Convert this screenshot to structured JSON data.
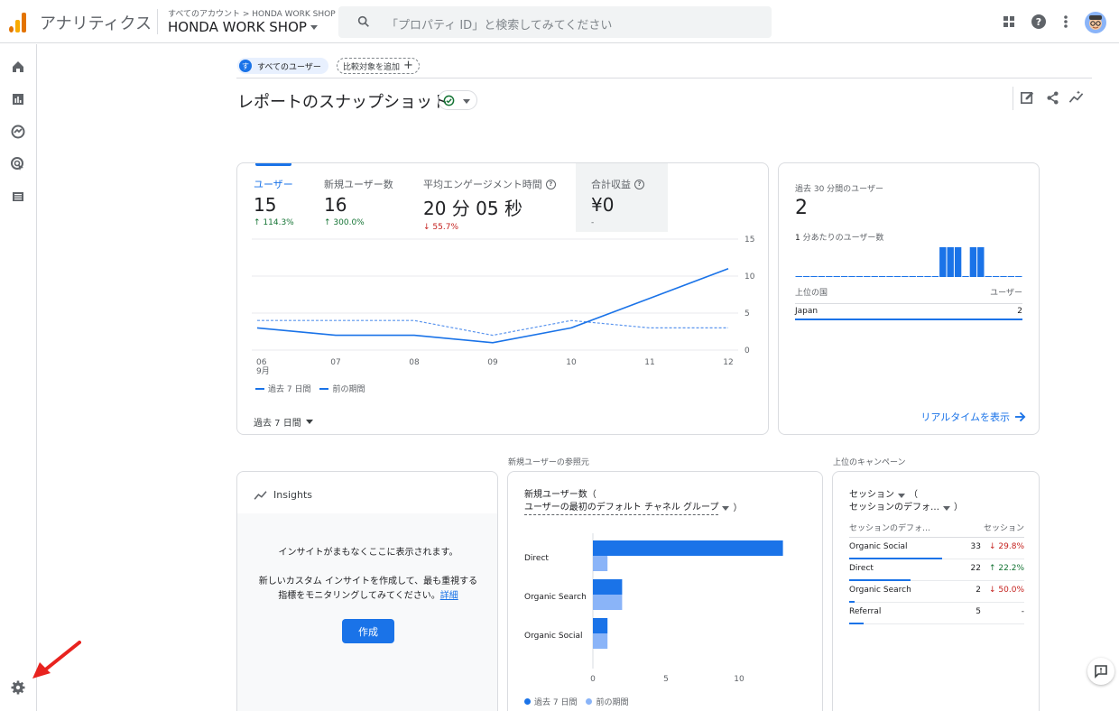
{
  "topbar": {
    "app_title": "アナリティクス",
    "account_crumb": "すべてのアカウント > HONDA WORK SHOP",
    "property_name": "HONDA WORK SHOP",
    "search_placeholder": "「プロパティ ID」と検索してみてください"
  },
  "header": {
    "segment_badge": "す",
    "segment_label": "すべてのユーザー",
    "add_comparison": "比較対象を追加",
    "page_title": "レポートのスナップショット"
  },
  "overview": {
    "metrics": [
      {
        "label": "ユーザー",
        "value": "15",
        "delta": "114.3%",
        "direction": "up"
      },
      {
        "label": "新規ユーザー数",
        "value": "16",
        "delta": "300.0%",
        "direction": "up"
      },
      {
        "label": "平均エンゲージメント時間",
        "value": "20 分 05 秒",
        "delta": "55.7%",
        "direction": "down"
      },
      {
        "label": "合計収益",
        "value": "¥0",
        "delta": "-",
        "direction": "none"
      }
    ],
    "chart_data": {
      "type": "line",
      "x": [
        "06",
        "07",
        "08",
        "09",
        "10",
        "11",
        "12"
      ],
      "x_month_label": "9月",
      "y_ticks": [
        "15",
        "10",
        "5",
        "0"
      ],
      "ylim": [
        0,
        15
      ],
      "series": [
        {
          "name": "過去 7 日間",
          "values": [
            3,
            2,
            2,
            1,
            3,
            7,
            11
          ],
          "style": "solid"
        },
        {
          "name": "前の期間",
          "values": [
            4,
            4,
            4,
            2,
            4,
            3,
            3
          ],
          "style": "dashed"
        }
      ]
    },
    "legend_current": "過去 7 日間",
    "legend_previous": "前の期間",
    "date_range": "過去 7 日間"
  },
  "realtime": {
    "title": "過去 30 分間のユーザー",
    "value": "2",
    "per_minute_prefix": "1",
    "per_minute_label": " 分あたりのユーザー数",
    "per_minute_bars": [
      0,
      0,
      0,
      0,
      0,
      0,
      0,
      0,
      0,
      0,
      0,
      0,
      0,
      0,
      0,
      0,
      0,
      0,
      0,
      1,
      1,
      1,
      0,
      1,
      1,
      0,
      0,
      0,
      0,
      0
    ],
    "col_country": "上位の国",
    "col_users": "ユーザー",
    "rows": [
      {
        "country": "Japan",
        "users": "2"
      }
    ],
    "link": "リアルタイムを表示"
  },
  "insights": {
    "title": "Insights",
    "message1": "インサイトがまもなくここに表示されます。",
    "message2": "新しいカスタム インサイトを作成して、最も重視する指標をモニタリングしてみてください。",
    "detail_link": "詳細",
    "create_button": "作成"
  },
  "acquisition": {
    "section_label": "新規ユーザーの参照元",
    "title_line1": "新規ユーザー数（",
    "title_line2": "ユーザーの最初のデフォルト チャネル グループ",
    "title_close": "）",
    "chart_data": {
      "type": "bar",
      "orientation": "horizontal",
      "categories": [
        "Direct",
        "Organic Search",
        "Organic Social"
      ],
      "series": [
        {
          "name": "過去 7 日間",
          "values": [
            13,
            2,
            1
          ]
        },
        {
          "name": "前の期間",
          "values": [
            1,
            2,
            1
          ]
        }
      ],
      "x_ticks": [
        "0",
        "5",
        "10"
      ],
      "xlim": [
        0,
        14
      ],
      "colors": [
        "#1a73e8",
        "#8ab4f8"
      ]
    },
    "legend_current": "過去 7 日間",
    "legend_previous": "前の期間"
  },
  "campaigns": {
    "section_label": "上位のキャンペーン",
    "title_line1": "セッション",
    "title_paren": "（",
    "title_line2": "セッションのデフォ…",
    "title_close": "）",
    "col1": "セッションのデフォ…",
    "col2": "セッション",
    "rows": [
      {
        "name": "Organic Social",
        "sessions": "33",
        "delta": "29.8%",
        "direction": "down",
        "share": 0.53
      },
      {
        "name": "Direct",
        "sessions": "22",
        "delta": "22.2%",
        "direction": "up",
        "share": 0.35
      },
      {
        "name": "Organic Search",
        "sessions": "2",
        "delta": "50.0%",
        "direction": "down",
        "share": 0.03
      },
      {
        "name": "Referral",
        "sessions": "5",
        "delta": "-",
        "direction": "none",
        "share": 0.08
      }
    ]
  },
  "colors": {
    "accent": "#1a73e8",
    "accent_light": "#8ab4f8",
    "up": "#137333",
    "down": "#c5221f"
  }
}
